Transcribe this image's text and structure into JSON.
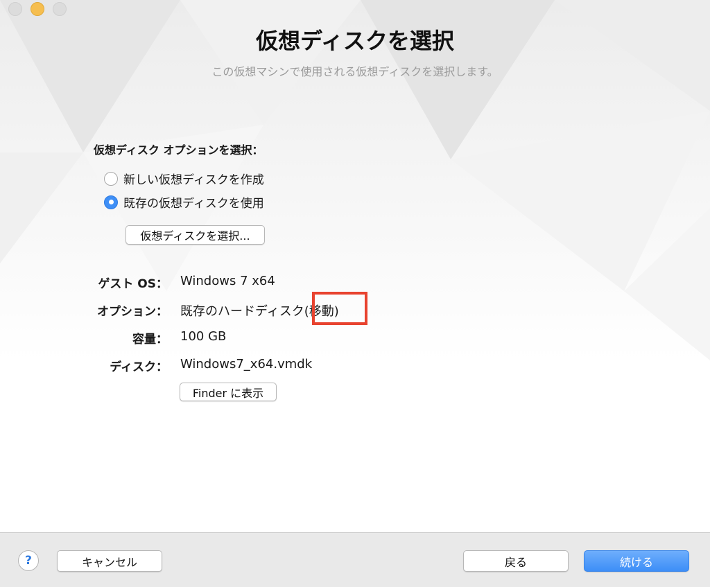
{
  "window": {
    "title": "仮想ディスクを選択",
    "subtitle": "この仮想マシンで使用される仮想ディスクを選択します。"
  },
  "disk_options": {
    "label": "仮想ディスク オプションを選択：",
    "choices": [
      {
        "label": "新しい仮想ディスクを作成",
        "selected": false
      },
      {
        "label": "既存の仮想ディスクを使用",
        "selected": true
      }
    ],
    "choose_button": "仮想ディスクを選択..."
  },
  "details": {
    "guest_os": {
      "label": "ゲスト OS：",
      "value": "Windows 7 x64"
    },
    "option": {
      "label": "オプション：",
      "value": "既存のハードディスク",
      "suffix": "(移動)"
    },
    "capacity": {
      "label": "容量：",
      "value": "100 GB"
    },
    "disk": {
      "label": "ディスク：",
      "value": "Windows7_x64.vmdk"
    },
    "show_in_finder": "Finder に表示"
  },
  "footer": {
    "help": "?",
    "cancel": "キャンセル",
    "back": "戻る",
    "continue": "続ける"
  },
  "colors": {
    "accent": "#3f8ff6",
    "highlight_box": "#e8432f"
  }
}
